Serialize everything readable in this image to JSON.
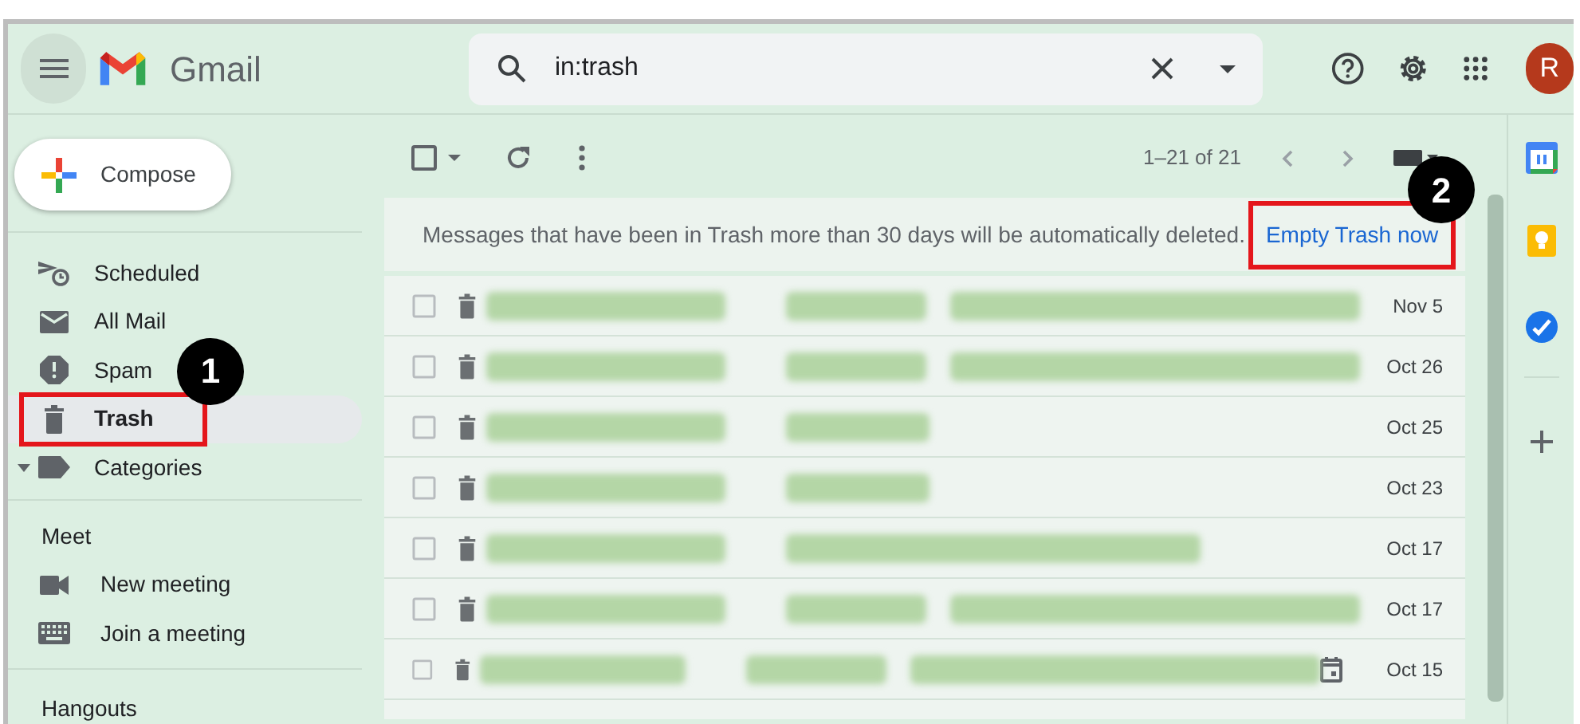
{
  "header": {
    "app_name": "Gmail",
    "search": {
      "value": "in:trash"
    },
    "avatar": "R"
  },
  "compose": "Compose",
  "sidebar": {
    "items": [
      {
        "label": "Scheduled",
        "selected": false
      },
      {
        "label": "All Mail",
        "selected": false
      },
      {
        "label": "Spam",
        "selected": false
      },
      {
        "label": "Trash",
        "selected": true,
        "annotation": "1"
      },
      {
        "label": "Categories",
        "selected": false
      }
    ]
  },
  "meet": {
    "title": "Meet",
    "items": [
      "New meeting",
      "Join a meeting"
    ]
  },
  "hangouts": {
    "title": "Hangouts"
  },
  "toolbar": {
    "range": "1–21 of 21"
  },
  "banner": {
    "text": "Messages that have been in Trash more than 30 days will be automatically deleted.",
    "action": "Empty Trash now",
    "annotation": "2"
  },
  "messages": [
    {
      "date": "Nov 5",
      "kind": "long",
      "checked": false,
      "has_event": false
    },
    {
      "date": "Oct 26",
      "kind": "long",
      "checked": false,
      "has_event": false
    },
    {
      "date": "Oct 25",
      "kind": "short",
      "checked": false,
      "has_event": false
    },
    {
      "date": "Oct 23",
      "kind": "short",
      "checked": false,
      "has_event": false
    },
    {
      "date": "Oct 17",
      "kind": "medium",
      "checked": false,
      "has_event": false
    },
    {
      "date": "Oct 17",
      "kind": "long",
      "checked": false,
      "has_event": false
    },
    {
      "date": "Oct 15",
      "kind": "long",
      "checked": false,
      "has_event": true
    }
  ]
}
